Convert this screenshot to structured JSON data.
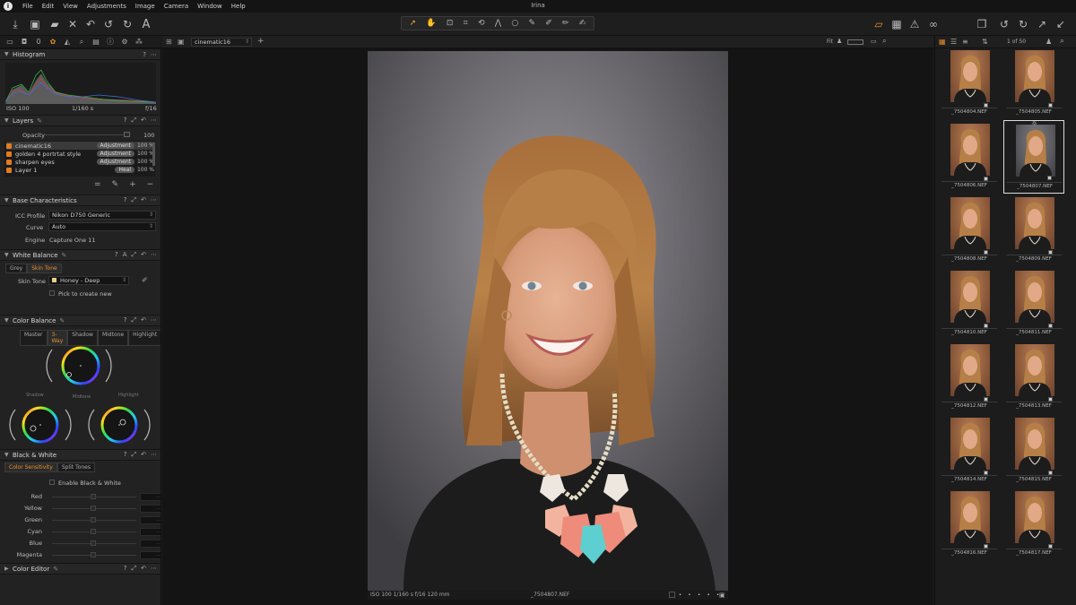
{
  "app": {
    "title": "Irina",
    "menu": [
      "File",
      "Edit",
      "View",
      "Adjustments",
      "Image",
      "Camera",
      "Window",
      "Help"
    ],
    "accent": "#e08a2c"
  },
  "toolstrip": {
    "icons": [
      "folder-icon",
      "camera-icon",
      "lens-icon",
      "color-icon",
      "exposure-icon",
      "details-icon",
      "metadata-icon",
      "info-icon",
      "gear-icon",
      "batch-icon"
    ]
  },
  "viewer_top": {
    "variant_name": "cinematic16",
    "zoom_label": "Fit",
    "counter": "1 of 50"
  },
  "histogram": {
    "title": "Histogram",
    "iso": "ISO 100",
    "shutter": "1/160 s",
    "aperture": "f/16"
  },
  "layers": {
    "title": "Layers",
    "opacity_label": "Opacity",
    "opacity_value": "100",
    "items": [
      {
        "name": "cinematic16",
        "tag": "Adjustment",
        "pct": "100 %"
      },
      {
        "name": "golden 4 portrtat style",
        "tag": "Adjustment",
        "pct": "100 %"
      },
      {
        "name": "sharpen eyes",
        "tag": "Adjustment",
        "pct": "100 %"
      },
      {
        "name": "Layer 1",
        "tag": "Heal",
        "pct": "100 %"
      }
    ]
  },
  "base": {
    "title": "Base Characteristics",
    "icc_label": "ICC Profile",
    "icc_value": "Nikon D750 Generic",
    "curve_label": "Curve",
    "curve_value": "Auto",
    "engine_label": "Engine",
    "engine_value": "Capture One 11"
  },
  "wb": {
    "title": "White Balance",
    "tabs": [
      "Grey",
      "Skin Tone"
    ],
    "skin_label": "Skin Tone",
    "skin_value": "Honey - Deep",
    "pick_label": "Pick to create new"
  },
  "color_balance": {
    "title": "Color Balance",
    "tabs": [
      "Master",
      "3-Way",
      "Shadow",
      "Midtone",
      "Highlight"
    ],
    "wheel_labels": [
      "Shadow",
      "Midtone",
      "Highlight"
    ]
  },
  "bw": {
    "title": "Black & White",
    "tabs": [
      "Color Sensitivity",
      "Split Tones"
    ],
    "enable_label": "Enable Black & White",
    "rows": [
      "Red",
      "Yellow",
      "Green",
      "Cyan",
      "Blue",
      "Magenta"
    ]
  },
  "color_editor": {
    "title": "Color Editor"
  },
  "photo_info": {
    "meta": "ISO 100  1/160 s  f/16  120 mm",
    "filename": "_7504807.NEF"
  },
  "thumbs": [
    "_7504804.NEF",
    "_7504805.NEF",
    "_7504806.NEF",
    "_7504807.NEF",
    "_7504808.NEF",
    "_7504809.NEF",
    "_7504810.NEF",
    "_7504811.NEF",
    "_7504812.NEF",
    "_7504813.NEF",
    "_7504814.NEF",
    "_7504815.NEF",
    "_7504816.NEF",
    "_7504817.NEF"
  ],
  "selected_thumb": "_7504807.NEF"
}
